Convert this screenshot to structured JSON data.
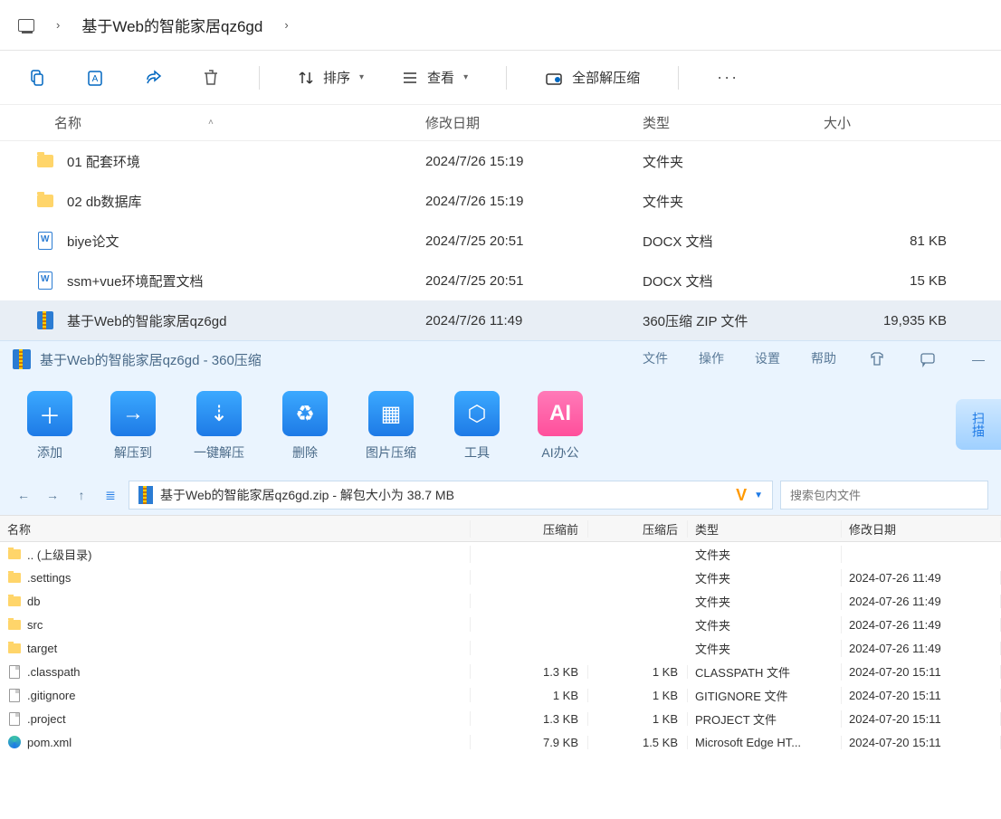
{
  "explorer": {
    "breadcrumb": "基于Web的智能家居qz6gd",
    "toolbar": {
      "sort": "排序",
      "view": "查看",
      "extract_all": "全部解压缩"
    },
    "headers": {
      "name": "名称",
      "date": "修改日期",
      "type": "类型",
      "size": "大小"
    },
    "rows": [
      {
        "icon": "folder",
        "name": "01 配套环境",
        "date": "2024/7/26 15:19",
        "type": "文件夹",
        "size": ""
      },
      {
        "icon": "folder",
        "name": "02 db数据库",
        "date": "2024/7/26 15:19",
        "type": "文件夹",
        "size": ""
      },
      {
        "icon": "doc",
        "name": "biye论文",
        "date": "2024/7/25 20:51",
        "type": "DOCX 文档",
        "size": "81 KB"
      },
      {
        "icon": "doc",
        "name": "ssm+vue环境配置文档",
        "date": "2024/7/25 20:51",
        "type": "DOCX 文档",
        "size": "15 KB"
      },
      {
        "icon": "zip",
        "name": "基于Web的智能家居qz6gd",
        "date": "2024/7/26 11:49",
        "type": "360压缩 ZIP 文件",
        "size": "19,935 KB",
        "selected": true
      }
    ]
  },
  "zip": {
    "title": "基于Web的智能家居qz6gd - 360压缩",
    "menus": {
      "file": "文件",
      "op": "操作",
      "set": "设置",
      "help": "帮助"
    },
    "tools": {
      "add": "添加",
      "ext": "解压到",
      "one": "一键解压",
      "del": "删除",
      "img": "图片压缩",
      "tool": "工具",
      "ai": "AI办公"
    },
    "scan": "扫描",
    "path": "基于Web的智能家居qz6gd.zip - 解包大小为 38.7 MB",
    "search_placeholder": "搜索包内文件",
    "headers": {
      "name": "名称",
      "pre": "压缩前",
      "post": "压缩后",
      "type": "类型",
      "date": "修改日期"
    },
    "rows": [
      {
        "icon": "folder",
        "name": ".. (上级目录)",
        "pre": "",
        "post": "",
        "type": "文件夹",
        "date": ""
      },
      {
        "icon": "folder",
        "name": ".settings",
        "pre": "",
        "post": "",
        "type": "文件夹",
        "date": "2024-07-26 11:49"
      },
      {
        "icon": "folder",
        "name": "db",
        "pre": "",
        "post": "",
        "type": "文件夹",
        "date": "2024-07-26 11:49"
      },
      {
        "icon": "folder",
        "name": "src",
        "pre": "",
        "post": "",
        "type": "文件夹",
        "date": "2024-07-26 11:49"
      },
      {
        "icon": "folder",
        "name": "target",
        "pre": "",
        "post": "",
        "type": "文件夹",
        "date": "2024-07-26 11:49"
      },
      {
        "icon": "file",
        "name": ".classpath",
        "pre": "1.3 KB",
        "post": "1 KB",
        "type": "CLASSPATH 文件",
        "date": "2024-07-20 15:11"
      },
      {
        "icon": "file",
        "name": ".gitignore",
        "pre": "1 KB",
        "post": "1 KB",
        "type": "GITIGNORE 文件",
        "date": "2024-07-20 15:11"
      },
      {
        "icon": "file",
        "name": ".project",
        "pre": "1.3 KB",
        "post": "1 KB",
        "type": "PROJECT 文件",
        "date": "2024-07-20 15:11"
      },
      {
        "icon": "edge",
        "name": "pom.xml",
        "pre": "7.9 KB",
        "post": "1.5 KB",
        "type": "Microsoft Edge HT...",
        "date": "2024-07-20 15:11"
      }
    ]
  }
}
